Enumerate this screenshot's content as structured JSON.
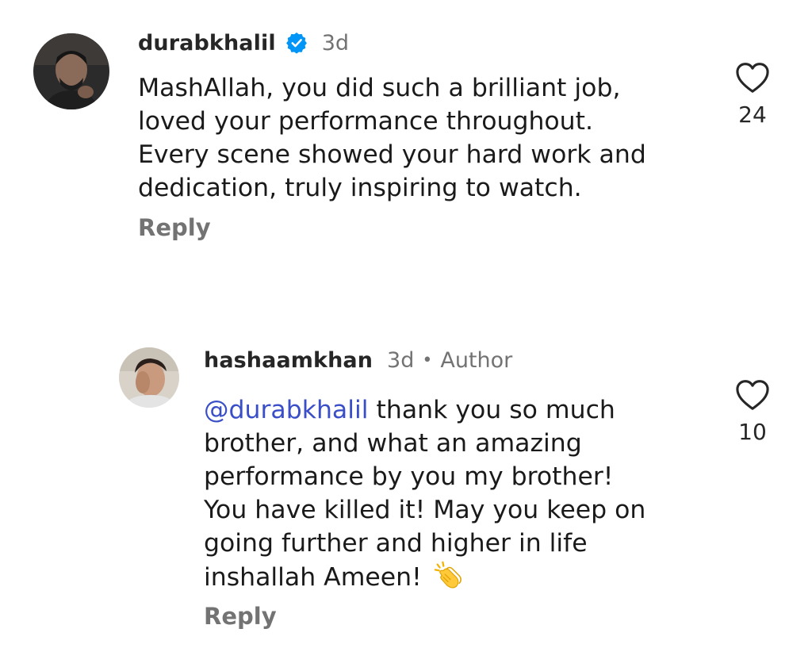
{
  "comments": [
    {
      "username": "durabkhalil",
      "verified": true,
      "time": "3d",
      "text": "MashAllah, you did such a brilliant job,\nloved your performance throughout.\nEvery scene showed your hard work and\ndedication, truly inspiring to watch.",
      "reply_label": "Reply",
      "likes": "24"
    },
    {
      "username": "hashaamkhan",
      "time": "3d",
      "separator": "•",
      "author_label": "Author",
      "mention": "@durabkhalil",
      "text": " thank you so much\nbrother, and what an amazing\nperformance by you my brother!\nYou have killed it! May you keep on\ngoing further and higher in life\ninshallah Ameen! ",
      "emoji": "clapping-hands",
      "reply_label": "Reply",
      "likes": "10"
    }
  ],
  "icons": {
    "verified": "verified-badge-icon",
    "like": "heart-outline-icon"
  },
  "colors": {
    "verified_blue": "#0095f6",
    "mention": "#3a4ec7",
    "secondary_text": "#737373"
  }
}
